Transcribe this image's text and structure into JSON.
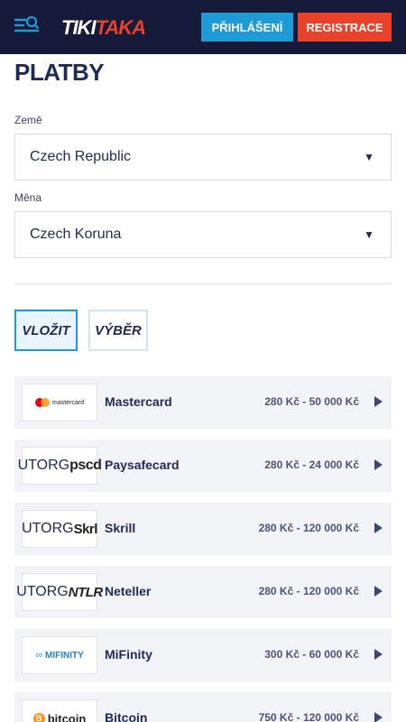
{
  "header": {
    "logo_part1": "TIKI",
    "logo_part2": "TAKA",
    "login_label": "PŘIHLÁŠENÍ",
    "register_label": "REGISTRACE"
  },
  "page": {
    "title": "PLATBY"
  },
  "country": {
    "label": "Země",
    "value": "Czech Republic"
  },
  "currency": {
    "label": "Měna",
    "value": "Czech Koruna"
  },
  "tabs": {
    "deposit": "VLOŽIT",
    "withdraw": "VÝBĚR"
  },
  "methods": [
    {
      "name": "Mastercard",
      "range": "280 Kč - 50 000 Kč",
      "logo_text": "mastercard"
    },
    {
      "name": "Paysafecard",
      "range": "280 Kč - 24 000 Kč",
      "logo_text": "pscd",
      "logo_tag": "UTORG"
    },
    {
      "name": "Skrill",
      "range": "280 Kč - 120 000 Kč",
      "logo_text": "Skrl",
      "logo_tag": "UTORG"
    },
    {
      "name": "Neteller",
      "range": "280 Kč - 120 000 Kč",
      "logo_text": "NTLR",
      "logo_tag": "UTORG"
    },
    {
      "name": "MiFinity",
      "range": "300 Kč - 60 000 Kč",
      "logo_text": "MIFINITY"
    },
    {
      "name": "Bitcoin",
      "range": "750 Kč - 120 000 Kč",
      "logo_text": "bitcoin",
      "logo_mark": "B"
    }
  ],
  "colors": {
    "header_bg": "#141a38",
    "accent_blue": "#1e9ad6",
    "accent_red": "#e8432a",
    "text_dark": "#1e2a5a"
  }
}
